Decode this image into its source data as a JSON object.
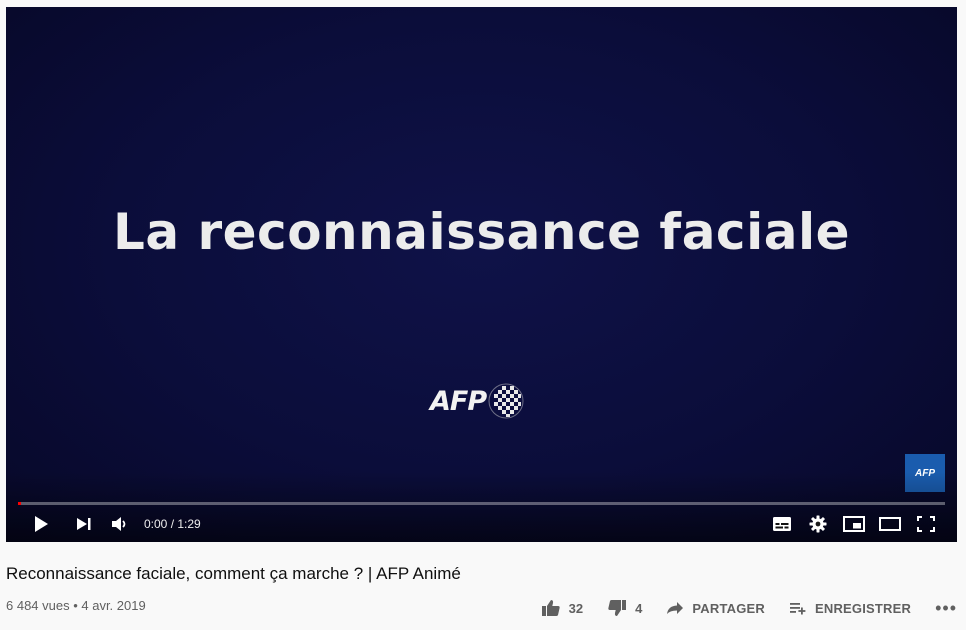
{
  "player": {
    "overlay_title": "La reconnaissance faciale",
    "logo_text": "AFP",
    "corner_logo_text": "AFP",
    "time_display": "0:00 / 1:29",
    "progress_fraction": 0.002,
    "colors": {
      "background": "#0b0d3a",
      "progress": "#ff0000",
      "corner_logo": "#1a5cae"
    },
    "controls": {
      "play": "play-icon",
      "next": "next-icon",
      "volume": "volume-icon",
      "subtitles": "subtitles-icon",
      "settings": "gear-icon",
      "miniplayer": "miniplayer-icon",
      "theater": "theater-icon",
      "fullscreen": "fullscreen-icon"
    }
  },
  "video": {
    "title": "Reconnaissance faciale, comment ça marche ? | AFP Animé",
    "meta": "6 484 vues • 4 avr. 2019"
  },
  "actions": {
    "likes": "32",
    "dislikes": "4",
    "share_label": "PARTAGER",
    "save_label": "ENREGISTRER",
    "more": "•••"
  }
}
